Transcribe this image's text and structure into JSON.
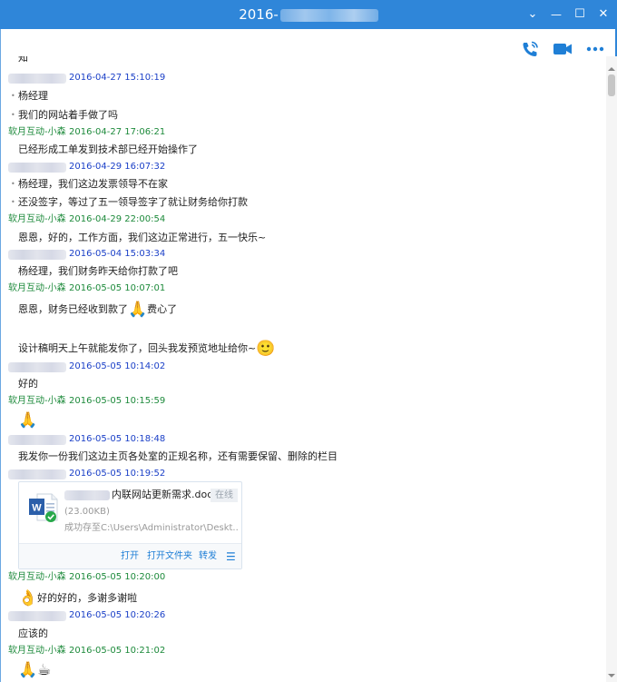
{
  "window": {
    "title": "2016-",
    "controls": {
      "minimize": "⌄",
      "restore": "—",
      "maximize": "☐",
      "close": "✕"
    }
  },
  "toolbar": {
    "icons": [
      "phone-call-icon",
      "video-call-icon",
      "more-icon"
    ]
  },
  "colors": {
    "titlebar": "#2f86d9",
    "mine": "#1d8a3b",
    "theirs": "#1a3fc7",
    "accent": "#1f7fd6"
  },
  "partial_top_text": "知",
  "messages": [
    {
      "sender": "",
      "time": "2016-04-27 15:10:19",
      "lines": [
        "杨经理",
        "我们的网站着手做了吗"
      ]
    },
    {
      "sender": "软月互动-小森",
      "time": "2016-04-27 17:06:21",
      "lines": [
        "已经形成工单发到技术部已经开始操作了"
      ]
    },
    {
      "sender": "",
      "time": "2016-04-29 16:07:32",
      "lines": [
        "杨经理，我们这边发票领导不在家",
        "还没签字，等过了五一领导签字了就让财务给你打款"
      ]
    },
    {
      "sender": "软月互动-小森",
      "time": "2016-04-29 22:00:54",
      "lines": [
        "恩恩，好的，工作方面，我们这边正常进行，五一快乐~"
      ]
    },
    {
      "sender": "",
      "time": "2016-05-04 15:03:34",
      "lines": [
        "杨经理，我们财务昨天给你打款了吧"
      ]
    },
    {
      "sender": "软月互动-小森",
      "time": "2016-05-05 10:07:01",
      "lines": [
        "恩恩，财务已经收到款了",
        "费心了",
        "设计稿明天上午就能发你了，回头我发预览地址给你~"
      ]
    },
    {
      "sender": "",
      "time": "2016-05-05 10:14:02",
      "lines": [
        "好的"
      ]
    },
    {
      "sender": "软月互动-小森",
      "time": "2016-05-05 10:15:59",
      "lines": []
    },
    {
      "sender": "",
      "time": "2016-05-05 10:18:48",
      "lines": [
        "我发你一份我们这边主页各处室的正规名称，还有需要保留、删除的栏目"
      ]
    },
    {
      "sender": "",
      "time": "2016-05-05 10:19:52",
      "lines": []
    },
    {
      "sender": "软月互动-小森",
      "time": "2016-05-05 10:20:00",
      "lines": [
        "好的好的，多谢多谢啦"
      ]
    },
    {
      "sender": "",
      "time": "2016-05-05 10:20:26",
      "lines": [
        "应该的"
      ]
    },
    {
      "sender": "软月互动-小森",
      "time": "2016-05-05 10:21:02",
      "lines": []
    }
  ],
  "emoji": {
    "pray": "🙏",
    "smile": "🙂",
    "ok": "👌",
    "coffee": "☕"
  },
  "file": {
    "name": "内联网站更新需求.doc",
    "status": "在线",
    "size": "(23.00KB)",
    "saved_to": "成功存至C:\\Users\\Administrator\\Deskt...",
    "actions": {
      "open": "打开",
      "open_folder": "打开文件夹",
      "forward": "转发",
      "menu": "☰"
    }
  }
}
